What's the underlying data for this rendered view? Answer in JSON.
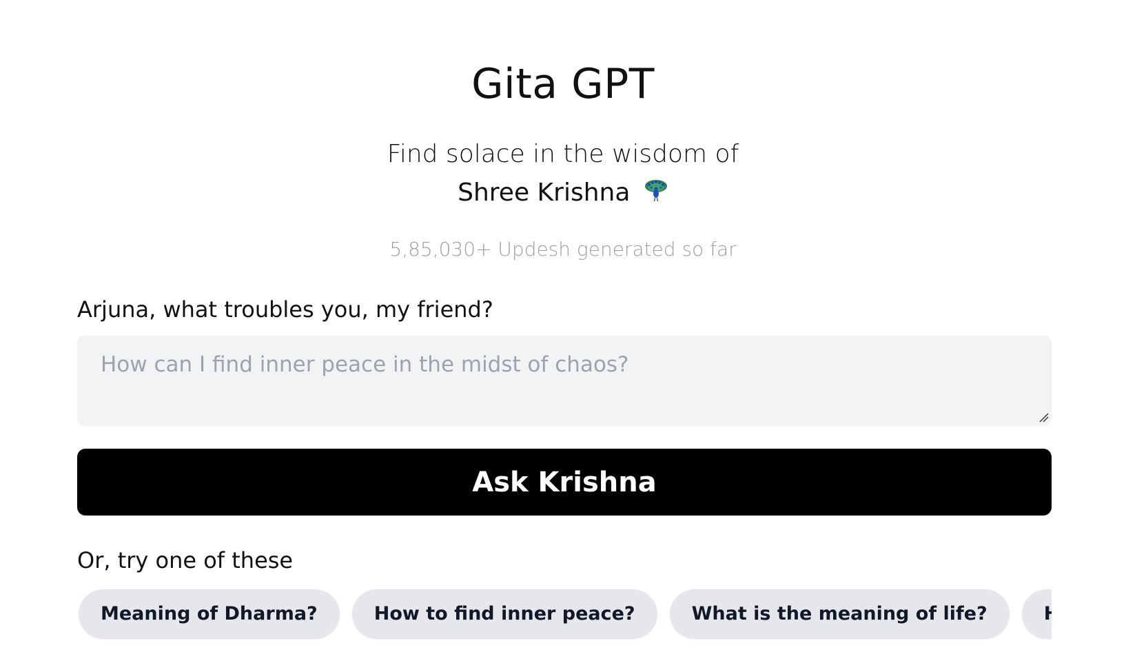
{
  "header": {
    "title": "Gita GPT",
    "subtitle_line1": "Find solace in the wisdom of",
    "subtitle_line2": "Shree Krishna",
    "subtitle_icon": "peacock-icon",
    "counter_text": "5,85,030+ Updesh generated so far"
  },
  "form": {
    "prompt_label": "Arjuna, what troubles you, my friend?",
    "question_value": "",
    "question_placeholder": "How can I find inner peace in the midst of chaos?",
    "submit_label": "Ask Krishna"
  },
  "suggestions": {
    "label": "Or, try one of these",
    "items": [
      {
        "label": "Meaning of Dharma?"
      },
      {
        "label": "How to find inner peace?"
      },
      {
        "label": "What is the meaning of life?"
      },
      {
        "label": "How to ha"
      }
    ]
  },
  "colors": {
    "background": "#ffffff",
    "button": "#000000",
    "button_text": "#ffffff",
    "input_background": "#f2f3f5",
    "chip_background": "#e6e7eb",
    "muted_text": "#9aa0a6"
  }
}
